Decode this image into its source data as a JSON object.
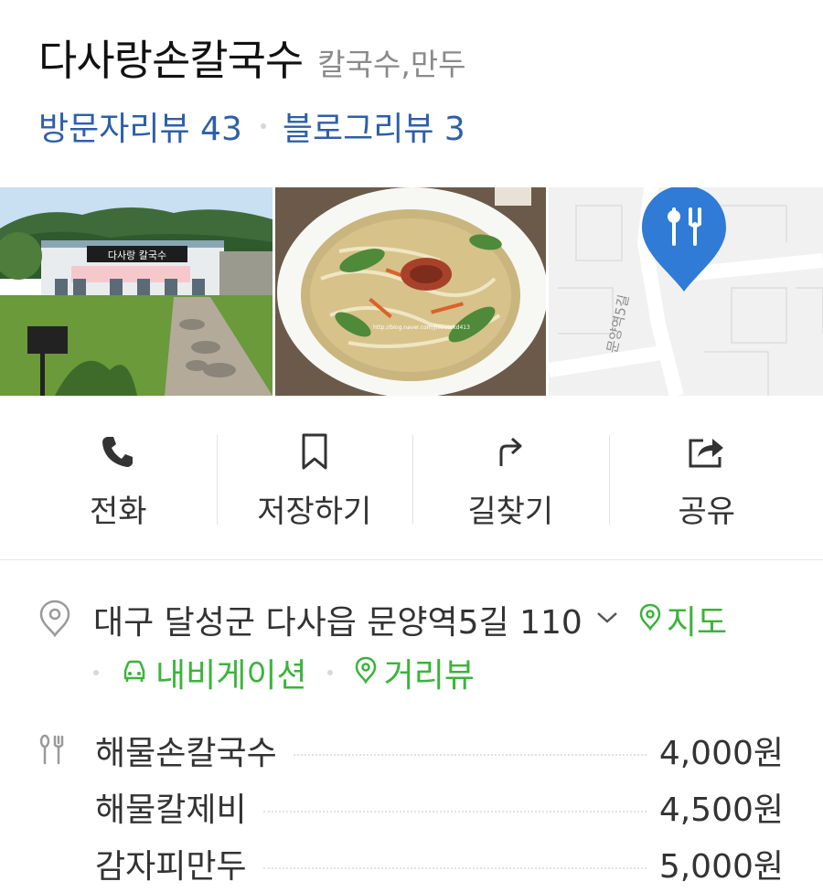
{
  "place": {
    "name": "다사랑손칼국수",
    "category": "칼국수,만두"
  },
  "reviews": {
    "visitor_label": "방문자리뷰 43",
    "blog_label": "블로그리뷰 3"
  },
  "photos": {
    "storefront_sign": "다사랑 칼국수",
    "noodle_watermark": "http://blog.naver.com/jhloverkd413",
    "map_street_label": "문양역5길"
  },
  "actions": [
    {
      "label": "전화",
      "icon": "phone-icon"
    },
    {
      "label": "저장하기",
      "icon": "bookmark-icon"
    },
    {
      "label": "길찾기",
      "icon": "directions-icon"
    },
    {
      "label": "공유",
      "icon": "share-icon"
    }
  ],
  "address": {
    "text": "대구 달성군 다사읍 문양역5길 110",
    "map_label": "지도",
    "navigation_label": "내비게이션",
    "streetview_label": "거리뷰"
  },
  "menu": [
    {
      "name": "해물손칼국수",
      "price": "4,000원"
    },
    {
      "name": "해물칼제비",
      "price": "4,500원"
    },
    {
      "name": "감자피만두",
      "price": "5,000원"
    }
  ],
  "colors": {
    "link_blue": "#2d5fa8",
    "green": "#3bb33b",
    "pin_blue": "#2f7bd6"
  }
}
